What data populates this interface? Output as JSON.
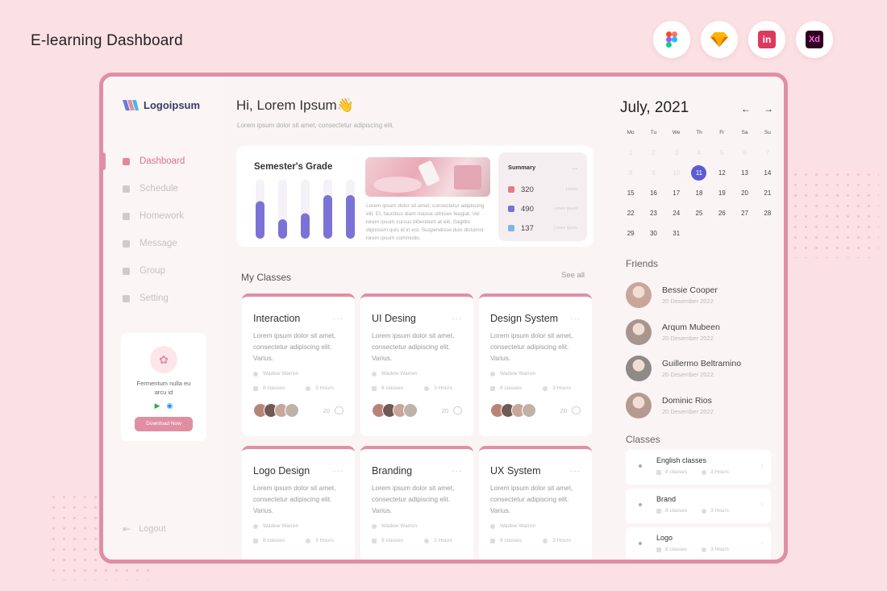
{
  "page": {
    "title": "E-learning Dashboard",
    "tools": [
      {
        "name": "figma-icon",
        "color": "#f24e1e"
      },
      {
        "name": "sketch-icon",
        "color": "#fdb300"
      },
      {
        "name": "invision-icon",
        "label": "in",
        "color": "#dc395f"
      },
      {
        "name": "adobe-xd-icon",
        "label": "Xd",
        "color": "#ff61f6"
      }
    ]
  },
  "sidebar": {
    "logo": "Logoipsum",
    "nav": [
      {
        "label": "Dashboard",
        "active": true
      },
      {
        "label": "Schedule"
      },
      {
        "label": "Homework"
      },
      {
        "label": "Message"
      },
      {
        "label": "Group"
      },
      {
        "label": "Setting"
      }
    ],
    "promo": {
      "text": "Fermentum nulla eu arcu id",
      "button": "Download Now"
    },
    "logout": "Logout"
  },
  "main": {
    "greeting": "Hi, Lorem Ipsum👋",
    "subtitle": "Lorem ipsum dolor sit amet, consectetur adipiscing elit.",
    "grade": {
      "title": "Semester's Grade",
      "bars": [
        0.62,
        0.32,
        0.42,
        0.72,
        0.72
      ],
      "tracks": [
        0.98,
        0.98,
        0.98,
        0.98,
        0.98
      ],
      "description": "Lorem ipsum dolor sit amet, consectetur adipiscing elit. Et, faucibus diam massa ultricies feugiat. Vel lorem ipsum cursus bibendum at elit. Sagittis dignissim quis id in est. Suspendisse duis dictumst lorem ipsum commodo."
    },
    "summary": {
      "title": "Summary",
      "more": "...",
      "rows": [
        {
          "value": "320",
          "label": "Lorem",
          "color": "#e07a8f"
        },
        {
          "value": "490",
          "label": "Lorem ipsum",
          "color": "#7b72d6"
        },
        {
          "value": "137",
          "label": "Lorem ipsum",
          "color": "#7ab6e6"
        }
      ]
    },
    "classes_title": "My Classes",
    "see_all": "See all",
    "classes": [
      {
        "title": "Interaction",
        "desc": "Lorem ipsum dolor sit amet, consectetur adipiscing elit. Varius.",
        "author": "Wadew Warren",
        "classes": "8 classes",
        "hours": "3 Hours",
        "count": "20"
      },
      {
        "title": "UI Desing",
        "desc": "Lorem ipsum dolor sit amet, consectetur adipiscing elit. Varius.",
        "author": "Wadew Warren",
        "classes": "8 classes",
        "hours": "3 Hours",
        "count": "20"
      },
      {
        "title": "Design System",
        "desc": "Lorem ipsum dolor sit amet, consectetur adipiscing elit. Varius.",
        "author": "Wadew Warren",
        "classes": "8 classes",
        "hours": "3 Hours",
        "count": "20"
      },
      {
        "title": "Logo Design",
        "desc": "Lorem ipsum dolor sit amet, consectetur adipiscing elit. Varius.",
        "author": "Wadew Warren",
        "classes": "8 classes",
        "hours": "3 Hours",
        "count": ""
      },
      {
        "title": "Branding",
        "desc": "Lorem ipsum dolor sit amet, consectetur adipiscing elit. Varius.",
        "author": "Wadew Warren",
        "classes": "8 classes",
        "hours": "3 Hours",
        "count": ""
      },
      {
        "title": "UX System",
        "desc": "Lorem ipsum dolor sit amet, consectetur adipiscing elit. Varius.",
        "author": "Wadew Warren",
        "classes": "8 classes",
        "hours": "3 Hours",
        "count": ""
      }
    ]
  },
  "calendar": {
    "month": "July, 2021",
    "prev": "←",
    "next": "→",
    "weekdays": [
      "Mo",
      "Tu",
      "We",
      "Th",
      "Fr",
      "Sa",
      "Su"
    ],
    "days": [
      {
        "d": "1",
        "faint": true
      },
      {
        "d": "2",
        "faint": true
      },
      {
        "d": "3",
        "faint": true
      },
      {
        "d": "4",
        "faint": true
      },
      {
        "d": "5",
        "faint": true
      },
      {
        "d": "6",
        "faint": true
      },
      {
        "d": "7",
        "faint": true
      },
      {
        "d": "8",
        "faint": true
      },
      {
        "d": "9",
        "faint": true
      },
      {
        "d": "10",
        "faint": true
      },
      {
        "d": "11",
        "today": true
      },
      {
        "d": "12"
      },
      {
        "d": "13"
      },
      {
        "d": "14"
      },
      {
        "d": "15"
      },
      {
        "d": "16"
      },
      {
        "d": "17"
      },
      {
        "d": "18"
      },
      {
        "d": "19"
      },
      {
        "d": "20"
      },
      {
        "d": "21"
      },
      {
        "d": "22"
      },
      {
        "d": "23"
      },
      {
        "d": "24"
      },
      {
        "d": "25"
      },
      {
        "d": "26"
      },
      {
        "d": "27"
      },
      {
        "d": "28"
      },
      {
        "d": "29"
      },
      {
        "d": "30"
      },
      {
        "d": "31"
      }
    ]
  },
  "friends": {
    "title": "Friends",
    "list": [
      {
        "name": "Bessie Cooper",
        "date": "20 Desember 2022"
      },
      {
        "name": "Arqum Mubeen",
        "date": "20 Desember 2022"
      },
      {
        "name": "Guillermo Beltramino",
        "date": "20 Desember 2022"
      },
      {
        "name": "Dominic Rios",
        "date": "20 Desember 2022"
      }
    ]
  },
  "right_classes": {
    "title": "Classes",
    "list": [
      {
        "name": "English classes",
        "classes": "8 classes",
        "hours": "3 Hours"
      },
      {
        "name": "Brand",
        "classes": "8 classes",
        "hours": "3 Hours"
      },
      {
        "name": "Logo",
        "classes": "8 classes",
        "hours": "3 Hours"
      }
    ]
  }
}
